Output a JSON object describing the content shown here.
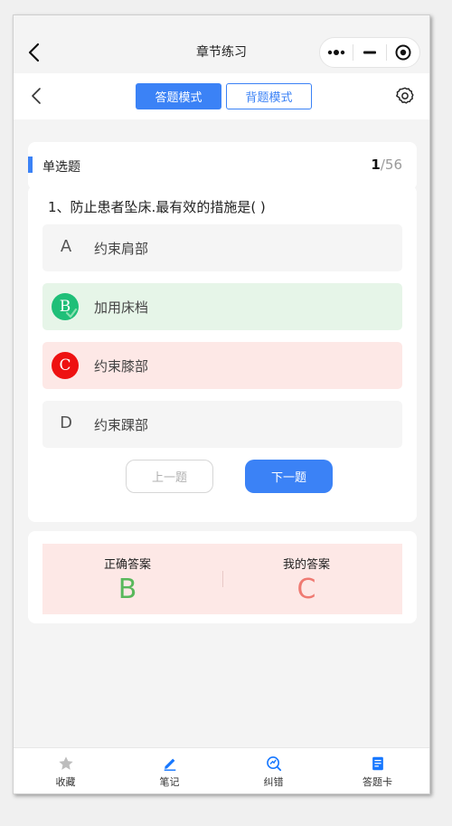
{
  "app": {
    "title": "章节练习"
  },
  "modes": {
    "answer_label": "答题模式",
    "recite_label": "背题模式",
    "active": "答题模式"
  },
  "question_type": {
    "label": "单选题",
    "current": "1",
    "total": "/56"
  },
  "question": {
    "text": "1、防止患者坠床.最有效的措施是( )",
    "options": [
      {
        "letter": "A",
        "text": "约束肩部",
        "state": "normal"
      },
      {
        "letter": "B",
        "text": "加用床档",
        "state": "correct"
      },
      {
        "letter": "C",
        "text": "约束膝部",
        "state": "wrong"
      },
      {
        "letter": "D",
        "text": "约束踝部",
        "state": "normal"
      }
    ]
  },
  "navigation": {
    "prev_label": "上一题",
    "next_label": "下一题"
  },
  "result": {
    "correct_label": "正确答案",
    "correct_value": "B",
    "mine_label": "我的答案",
    "mine_value": "C"
  },
  "tabs": [
    {
      "label": "收藏",
      "icon": "star-icon"
    },
    {
      "label": "笔记",
      "icon": "pencil-icon"
    },
    {
      "label": "纠错",
      "icon": "correction-icon"
    },
    {
      "label": "答题卡",
      "icon": "answer-card-icon"
    }
  ],
  "colors": {
    "accent": "#3b82f6",
    "correct_bg": "#e6f5e8",
    "correct_badge": "#1fbf78",
    "wrong_bg": "#fde8e6",
    "wrong_badge": "#ee1111",
    "correct_text": "#59b85b",
    "wrong_text": "#ef7a72"
  }
}
